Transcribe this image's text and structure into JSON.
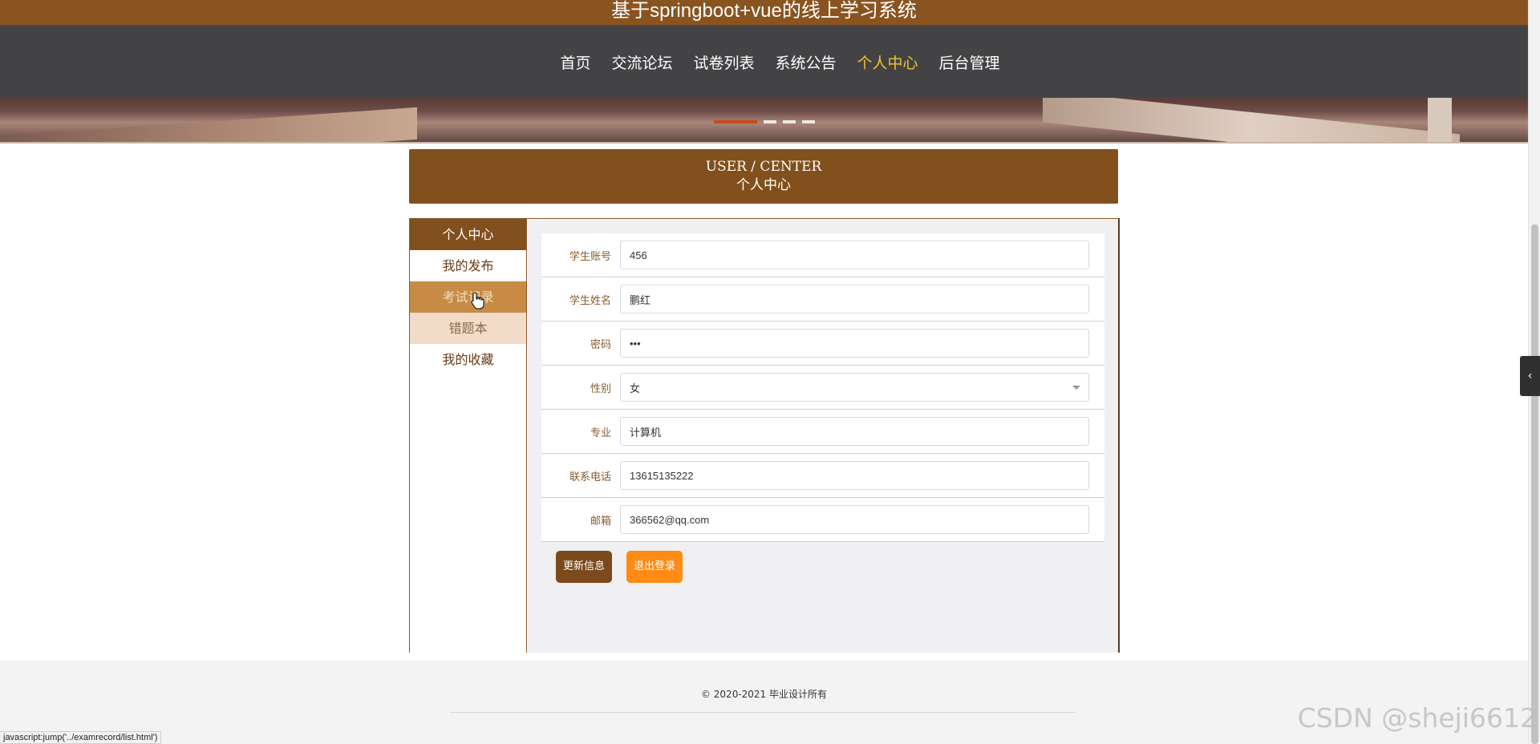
{
  "site": {
    "title": "基于springboot+vue的线上学习系统"
  },
  "nav": {
    "items": [
      "首页",
      "交流论坛",
      "试卷列表",
      "系统公告",
      "个人中心",
      "后台管理"
    ],
    "active": "个人中心"
  },
  "banner": {
    "slides": 4,
    "active_slide": 1
  },
  "section": {
    "en": "USER / CENTER",
    "zh": "个人中心"
  },
  "sidebar": {
    "items": [
      {
        "label": "个人中心"
      },
      {
        "label": "我的发布"
      },
      {
        "label": "考试记录"
      },
      {
        "label": "错题本"
      },
      {
        "label": "我的收藏"
      }
    ],
    "active": "个人中心",
    "hovered": "考试记录"
  },
  "form": {
    "fields": [
      {
        "label": "学生账号",
        "value": "456"
      },
      {
        "label": "学生姓名",
        "value": "鹏红"
      },
      {
        "label": "密码",
        "value": "•••"
      },
      {
        "label": "性别",
        "value": "女"
      },
      {
        "label": "专业",
        "value": "计算机"
      },
      {
        "label": "联系电话",
        "value": "13615135222"
      },
      {
        "label": "邮箱",
        "value": "366562@qq.com"
      }
    ],
    "update_label": "更新信息",
    "logout_label": "退出登录"
  },
  "footer": {
    "copyright": "© 2020-2021 毕业设计所有"
  },
  "status_link": "javascript:jump('../examrecord/list.html')",
  "watermark": "CSDN @sheji6612",
  "colors": {
    "brand_brown": "#81501c",
    "nav_bg": "#434346",
    "nav_active": "#f5c030",
    "logout_orange": "#ff8a14"
  },
  "icons": {
    "cursor": "hand-pointer-icon",
    "side_tab": "chevron-left-icon",
    "select_caret": "caret-down-icon"
  }
}
